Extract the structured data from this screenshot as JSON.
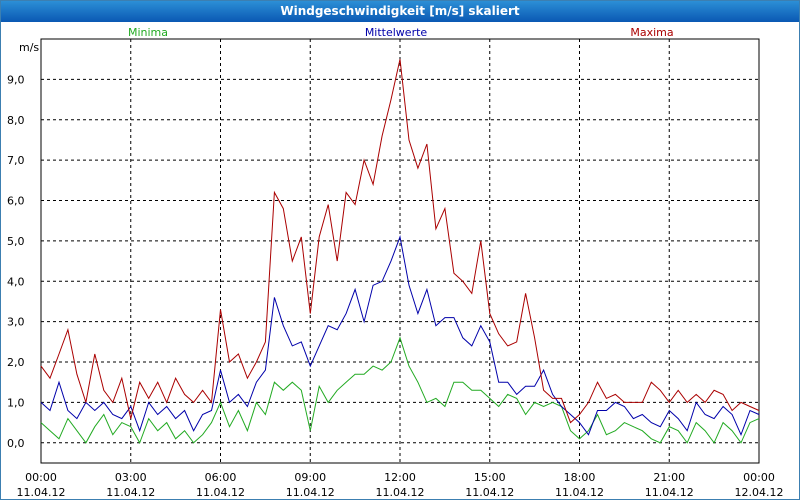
{
  "window": {
    "title": "Windgeschwindigkeit [m/s] skaliert"
  },
  "colors": {
    "minima": "#22aa22",
    "mittelwerte": "#0000aa",
    "maxima": "#aa0000",
    "titlebar": "#1a6fc4",
    "grid": "#000000"
  },
  "chart_data": {
    "type": "line",
    "title": "Windgeschwindigkeit [m/s] skaliert",
    "ylabel": "m/s",
    "xlabel": "",
    "ylim": [
      -0.5,
      10.0
    ],
    "yticks": [
      "0,0",
      "1,0",
      "2,0",
      "3,0",
      "4,0",
      "5,0",
      "6,0",
      "7,0",
      "8,0",
      "9,0"
    ],
    "xticks": [
      {
        "time": "00:00",
        "date": "11.04.12"
      },
      {
        "time": "03:00",
        "date": "11.04.12"
      },
      {
        "time": "06:00",
        "date": "11.04.12"
      },
      {
        "time": "09:00",
        "date": "11.04.12"
      },
      {
        "time": "12:00",
        "date": "11.04.12"
      },
      {
        "time": "15:00",
        "date": "11.04.12"
      },
      {
        "time": "18:00",
        "date": "11.04.12"
      },
      {
        "time": "21:00",
        "date": "11.04.12"
      },
      {
        "time": "00:00",
        "date": "12.04.12"
      }
    ],
    "grid": true,
    "legend_placement": "top",
    "series": [
      {
        "name": "Minima",
        "color": "#22aa22",
        "hours": [
          0,
          0.3,
          0.6,
          0.9,
          1.2,
          1.5,
          1.8,
          2.1,
          2.4,
          2.7,
          3.0,
          3.3,
          3.6,
          3.9,
          4.2,
          4.5,
          4.8,
          5.1,
          5.4,
          5.7,
          6.0,
          6.3,
          6.6,
          6.9,
          7.2,
          7.5,
          7.8,
          8.1,
          8.4,
          8.7,
          9.0,
          9.3,
          9.6,
          9.9,
          10.2,
          10.5,
          10.8,
          11.1,
          11.4,
          11.7,
          12.0,
          12.3,
          12.6,
          12.9,
          13.2,
          13.5,
          13.8,
          14.1,
          14.4,
          14.7,
          15.0,
          15.3,
          15.6,
          15.9,
          16.2,
          16.5,
          16.8,
          17.1,
          17.4,
          17.7,
          18.0,
          18.3,
          18.6,
          18.9,
          19.2,
          19.5,
          19.8,
          20.1,
          20.4,
          20.7,
          21.0,
          21.3,
          21.6,
          21.9,
          22.2,
          22.5,
          22.8,
          23.1,
          23.4,
          23.7,
          24.0
        ],
        "values": [
          0.5,
          0.3,
          0.1,
          0.6,
          0.3,
          0.0,
          0.4,
          0.7,
          0.2,
          0.5,
          0.4,
          0.0,
          0.6,
          0.3,
          0.5,
          0.1,
          0.3,
          0.0,
          0.2,
          0.5,
          1.0,
          0.4,
          0.8,
          0.3,
          1.0,
          0.7,
          1.5,
          1.3,
          1.5,
          1.3,
          0.3,
          1.4,
          1.0,
          1.3,
          1.5,
          1.7,
          1.7,
          1.9,
          1.8,
          2.0,
          2.6,
          1.9,
          1.5,
          1.0,
          1.1,
          0.9,
          1.5,
          1.5,
          1.3,
          1.3,
          1.1,
          0.9,
          1.2,
          1.1,
          0.7,
          1.0,
          0.9,
          1.0,
          0.9,
          0.3,
          0.1,
          0.3,
          0.7,
          0.2,
          0.3,
          0.5,
          0.4,
          0.3,
          0.1,
          0.0,
          0.4,
          0.3,
          0.0,
          0.5,
          0.3,
          0.0,
          0.5,
          0.3,
          0.0,
          0.5,
          0.6
        ]
      },
      {
        "name": "Mittelwerte",
        "color": "#0000aa",
        "hours": [
          0,
          0.3,
          0.6,
          0.9,
          1.2,
          1.5,
          1.8,
          2.1,
          2.4,
          2.7,
          3.0,
          3.3,
          3.6,
          3.9,
          4.2,
          4.5,
          4.8,
          5.1,
          5.4,
          5.7,
          6.0,
          6.3,
          6.6,
          6.9,
          7.2,
          7.5,
          7.8,
          8.1,
          8.4,
          8.7,
          9.0,
          9.3,
          9.6,
          9.9,
          10.2,
          10.5,
          10.8,
          11.1,
          11.4,
          11.7,
          12.0,
          12.3,
          12.6,
          12.9,
          13.2,
          13.5,
          13.8,
          14.1,
          14.4,
          14.7,
          15.0,
          15.3,
          15.6,
          15.9,
          16.2,
          16.5,
          16.8,
          17.1,
          17.4,
          17.7,
          18.0,
          18.3,
          18.6,
          18.9,
          19.2,
          19.5,
          19.8,
          20.1,
          20.4,
          20.7,
          21.0,
          21.3,
          21.6,
          21.9,
          22.2,
          22.5,
          22.8,
          23.1,
          23.4,
          23.7,
          24.0
        ],
        "values": [
          1.0,
          0.8,
          1.5,
          0.8,
          0.6,
          1.0,
          0.8,
          1.0,
          0.7,
          0.6,
          0.9,
          0.3,
          1.0,
          0.7,
          0.9,
          0.6,
          0.8,
          0.3,
          0.7,
          0.8,
          1.8,
          1.0,
          1.2,
          0.9,
          1.5,
          1.8,
          3.6,
          2.9,
          2.4,
          2.5,
          1.9,
          2.4,
          2.9,
          2.8,
          3.2,
          3.8,
          3.0,
          3.9,
          4.0,
          4.5,
          5.1,
          3.9,
          3.2,
          3.8,
          2.9,
          3.1,
          3.1,
          2.6,
          2.4,
          2.9,
          2.5,
          1.5,
          1.5,
          1.2,
          1.4,
          1.4,
          1.8,
          1.2,
          0.9,
          0.7,
          0.5,
          0.2,
          0.8,
          0.8,
          1.0,
          0.9,
          0.6,
          0.7,
          0.5,
          0.4,
          0.8,
          0.6,
          0.3,
          1.0,
          0.7,
          0.6,
          0.9,
          0.7,
          0.2,
          0.8,
          0.7
        ]
      },
      {
        "name": "Maxima",
        "color": "#aa0000",
        "hours": [
          0,
          0.3,
          0.6,
          0.9,
          1.2,
          1.5,
          1.8,
          2.1,
          2.4,
          2.7,
          3.0,
          3.3,
          3.6,
          3.9,
          4.2,
          4.5,
          4.8,
          5.1,
          5.4,
          5.7,
          6.0,
          6.3,
          6.6,
          6.9,
          7.2,
          7.5,
          7.8,
          8.1,
          8.4,
          8.7,
          9.0,
          9.3,
          9.6,
          9.9,
          10.2,
          10.5,
          10.8,
          11.1,
          11.4,
          11.7,
          12.0,
          12.3,
          12.6,
          12.9,
          13.2,
          13.5,
          13.8,
          14.1,
          14.4,
          14.7,
          15.0,
          15.3,
          15.6,
          15.9,
          16.2,
          16.5,
          16.8,
          17.1,
          17.4,
          17.7,
          18.0,
          18.3,
          18.6,
          18.9,
          19.2,
          19.5,
          19.8,
          20.1,
          20.4,
          20.7,
          21.0,
          21.3,
          21.6,
          21.9,
          22.2,
          22.5,
          22.8,
          23.1,
          23.4,
          23.7,
          24.0
        ],
        "values": [
          1.9,
          1.6,
          2.2,
          2.8,
          1.7,
          1.0,
          2.2,
          1.3,
          1.0,
          1.6,
          0.6,
          1.5,
          1.1,
          1.5,
          1.0,
          1.6,
          1.2,
          1.0,
          1.3,
          1.0,
          3.3,
          2.0,
          2.2,
          1.6,
          2.0,
          2.5,
          6.2,
          5.8,
          4.5,
          5.1,
          3.2,
          5.1,
          5.9,
          4.5,
          6.2,
          5.9,
          7.0,
          6.4,
          7.6,
          8.5,
          9.5,
          7.5,
          6.8,
          7.4,
          5.3,
          5.8,
          4.2,
          4.0,
          3.7,
          5.0,
          3.2,
          2.7,
          2.4,
          2.5,
          3.7,
          2.6,
          1.3,
          1.1,
          1.1,
          0.5,
          0.7,
          1.0,
          1.5,
          1.1,
          1.2,
          1.0,
          1.0,
          1.0,
          1.5,
          1.3,
          1.0,
          1.3,
          1.0,
          1.2,
          1.0,
          1.3,
          1.2,
          0.8,
          1.0,
          0.9,
          0.8
        ]
      }
    ]
  }
}
